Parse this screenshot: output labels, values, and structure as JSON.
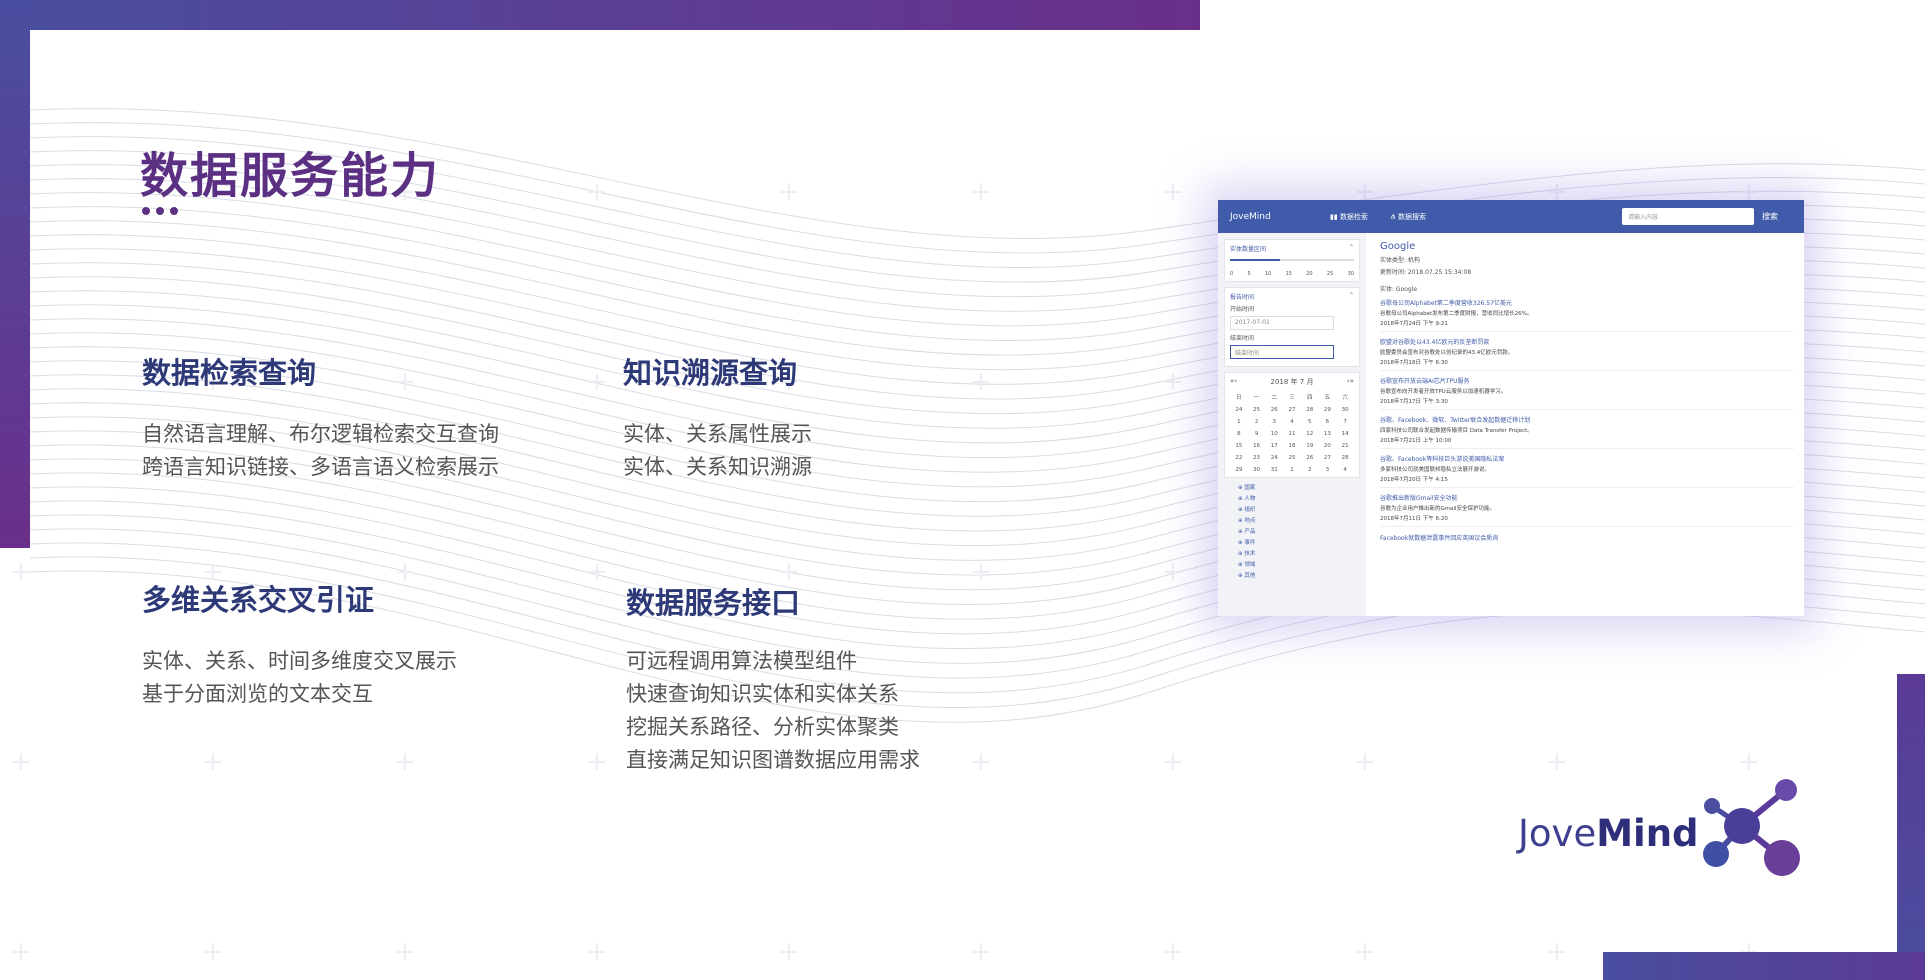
{
  "title": "数据服务能力",
  "sections": [
    {
      "heading": "数据检索查询",
      "lines": [
        "自然语言理解、布尔逻辑检索交互查询",
        "跨语言知识链接、多语言语义检索展示"
      ]
    },
    {
      "heading": "知识溯源查询",
      "lines": [
        "实体、关系属性展示",
        "实体、关系知识溯源"
      ]
    },
    {
      "heading": "多维关系交叉引证",
      "lines": [
        "实体、关系、时间多维度交叉展示",
        "基于分面浏览的文本交互"
      ]
    },
    {
      "heading": "数据服务接口",
      "lines": [
        "可远程调用算法模型组件",
        "快速查询知识实体和实体关系",
        "挖掘关系路径、分析实体聚类",
        "直接满足知识图谱数据应用需求"
      ]
    }
  ],
  "brand": {
    "light": "Jove",
    "bold": "Mind"
  },
  "colors": {
    "accent": "#5b2f82",
    "heading": "#2e3a78",
    "ui_blue": "#3f5ba9"
  },
  "screenshot": {
    "logo": "JoveMind",
    "nav": [
      "数据检索",
      "数据搜索"
    ],
    "search_placeholder": "请输入内容",
    "search_button": "搜索",
    "panel1_title": "实体数量区间",
    "ticks": [
      "0",
      "5",
      "10",
      "15",
      "20",
      "25",
      "30"
    ],
    "panel2_title": "报告时间",
    "start_label": "开始时间",
    "start_value": "2017-07-01",
    "end_label": "结束时间",
    "end_placeholder": "结束时间",
    "calendar_title": "2018 年 7 月",
    "weekdays": [
      "日",
      "一",
      "二",
      "三",
      "四",
      "五",
      "六"
    ],
    "days": [
      "24",
      "25",
      "26",
      "27",
      "28",
      "29",
      "30",
      "1",
      "2",
      "3",
      "4",
      "5",
      "6",
      "7",
      "8",
      "9",
      "10",
      "11",
      "12",
      "13",
      "14",
      "15",
      "16",
      "17",
      "18",
      "19",
      "20",
      "21",
      "22",
      "23",
      "24",
      "25",
      "26",
      "27",
      "28",
      "29",
      "30",
      "31",
      "1",
      "2",
      "3",
      "4"
    ],
    "tags": [
      "国家",
      "人物",
      "组织",
      "地点",
      "产品",
      "事件",
      "技术",
      "领域",
      "其他"
    ],
    "entity_title": "Google",
    "entity_type": "实体类型: 机构",
    "update_time": "更新时间: 2018.07.25 15:34:08",
    "query": "实体: Google",
    "results": [
      {
        "link": "谷歌母公司Alphabet第二季度营收326.57亿美元",
        "desc": "谷歌母公司Alphabet发布第二季度财报，营收同比增长26%。",
        "time": "2018年7月24日 下午 9:21"
      },
      {
        "link": "欧盟对谷歌处以43.4亿欧元的反垄断罚款",
        "desc": "欧盟委员会宣布对谷歌处以创纪录的43.4亿欧元罚款。",
        "time": "2018年7月18日 下午 6:30"
      },
      {
        "link": "谷歌宣布开放云端AI芯片TPU服务",
        "desc": "谷歌宣布向开发者开放TPU云服务以加速机器学习。",
        "time": "2018年7月17日 下午 3:30"
      },
      {
        "link": "谷歌、Facebook、微软、Twitter联合发起数据迁移计划",
        "desc": "四家科技公司联合发起数据传输项目 Data Transfer Project。",
        "time": "2018年7月21日 上午 10:00"
      },
      {
        "link": "谷歌、Facebook等科技巨头游说美国隐私法案",
        "desc": "多家科技公司就美国联邦隐私立法展开游说。",
        "time": "2018年7月20日 下午 4:15"
      },
      {
        "link": "谷歌推出新版Gmail安全功能",
        "desc": "谷歌为企业用户推出新的Gmail安全保护功能。",
        "time": "2018年7月11日 下午 6:20"
      }
    ],
    "more": "Facebook就数据泄露事件回应英国议会质询"
  }
}
